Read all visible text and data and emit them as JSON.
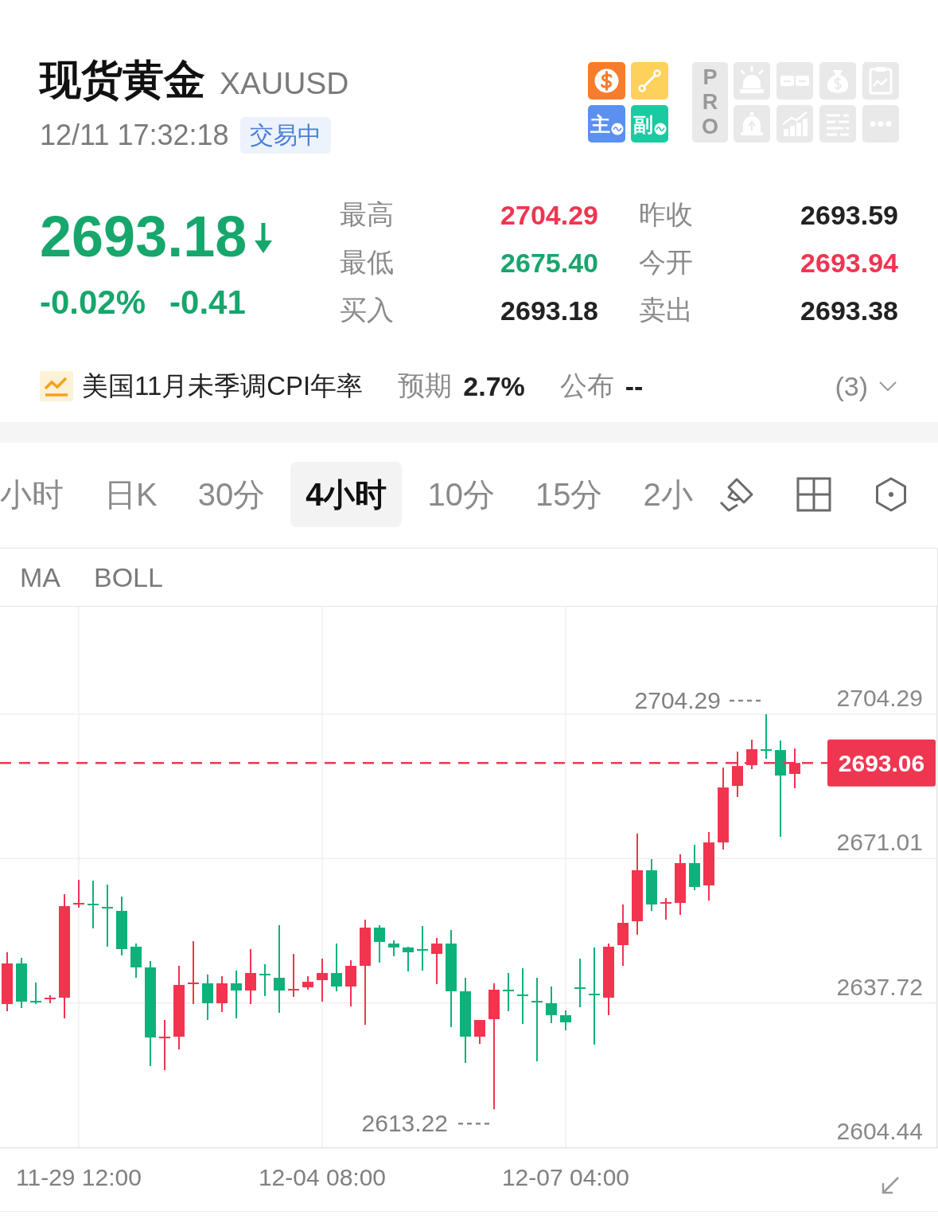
{
  "header": {
    "title": "现货黄金",
    "symbol": "XAUUSD",
    "time": "12/11 17:32:18",
    "status": "交易中"
  },
  "quick_tools": [
    {
      "kind": "dollar",
      "color": "#f77c2c"
    },
    {
      "kind": "line",
      "color": "#fdd15b"
    },
    {
      "kind": "label",
      "label": "主",
      "color": "#5c90f0"
    },
    {
      "kind": "label",
      "label": "副",
      "color": "#1ccaa1"
    }
  ],
  "pro_panel": {
    "label": "PRO",
    "disabled": true,
    "tools": [
      {
        "kind": "siren"
      },
      {
        "kind": "cards"
      },
      {
        "kind": "money_bag"
      },
      {
        "kind": "clipboard"
      },
      {
        "kind": "bell"
      },
      {
        "kind": "bar_chart"
      },
      {
        "kind": "list"
      },
      {
        "kind": "more"
      }
    ]
  },
  "quote": {
    "price": "2693.18",
    "down": true,
    "change_percent": "-0.02%",
    "change": "-0.41"
  },
  "stats": [
    {
      "label": "最高",
      "value": "2704.29",
      "color": "#ef3651"
    },
    {
      "label": "昨收",
      "value": "2693.59",
      "color": "#222222"
    },
    {
      "label": "最低",
      "value": "2675.40",
      "color": "#17a66c"
    },
    {
      "label": "今开",
      "value": "2693.94",
      "color": "#ef3651"
    },
    {
      "label": "买入",
      "value": "2693.18",
      "color": "#222222"
    },
    {
      "label": "卖出",
      "value": "2693.38",
      "color": "#222222"
    }
  ],
  "event": {
    "title": "美国11月未季调CPI年率",
    "forecast_label": "预期",
    "forecast": "2.7%",
    "actual_label": "公布",
    "actual": "--",
    "count": "(3)",
    "expanded": false
  },
  "period_tabs": [
    {
      "label": "小时",
      "selected": false
    },
    {
      "label": "日K",
      "selected": false
    },
    {
      "label": "30分",
      "selected": false
    },
    {
      "label": "4小时",
      "selected": true
    },
    {
      "label": "10分",
      "selected": false
    },
    {
      "label": "15分",
      "selected": false
    },
    {
      "label": "2小",
      "selected": false
    }
  ],
  "indicators": [
    "MA",
    "BOLL"
  ],
  "chart": {
    "chart_data": {
      "type": "candlestick",
      "categories": [
        null,
        null,
        null,
        null,
        null,
        "11-29 12:00",
        null,
        null,
        null,
        null,
        null,
        null,
        null,
        null,
        null,
        null,
        null,
        null,
        null,
        null,
        null,
        null,
        "12-04 08:00",
        null,
        null,
        null,
        null,
        null,
        null,
        null,
        null,
        null,
        null,
        null,
        null,
        null,
        null,
        null,
        null,
        "12-07 04:00",
        null,
        null,
        null,
        null,
        null,
        null,
        null,
        null,
        null,
        null,
        null,
        null,
        null,
        null,
        null,
        null
      ],
      "ohlc": [
        [
          2637.47,
          2649.4,
          2635.82,
          2646.83
        ],
        [
          2646.83,
          2648.12,
          2636.56,
          2638.02
        ],
        [
          2638.21,
          2642.43,
          2637.47,
          2637.84
        ],
        [
          2638.57,
          2639.49,
          2637.66,
          2638.94
        ],
        [
          2638.94,
          2662.8,
          2634.17,
          2660.05
        ],
        [
          2660.42,
          2666.11,
          2659.68,
          2660.78
        ],
        [
          2660.6,
          2665.92,
          2654.91,
          2660.23
        ],
        [
          2659.87,
          2665.01,
          2650.69,
          2659.5
        ],
        [
          2658.95,
          2662.25,
          2648.67,
          2650.14
        ],
        [
          2650.69,
          2651.42,
          2643.53,
          2645.92
        ],
        [
          2645.92,
          2647.39,
          2623.16,
          2629.76
        ],
        [
          2629.58,
          2633.8,
          2622.24,
          2629.95
        ],
        [
          2629.95,
          2646.28,
          2627.01,
          2641.88
        ],
        [
          2642.06,
          2651.97,
          2637.47,
          2642.43
        ],
        [
          2642.25,
          2644.26,
          2633.8,
          2637.66
        ],
        [
          2637.66,
          2643.9,
          2635.64,
          2642.25
        ],
        [
          2642.25,
          2645.18,
          2634.17,
          2640.59
        ],
        [
          2640.59,
          2650.14,
          2637.47,
          2644.63
        ],
        [
          2644.45,
          2646.65,
          2639.31,
          2644.08
        ],
        [
          2643.53,
          2655.64,
          2635.45,
          2640.59
        ],
        [
          2640.59,
          2649.04,
          2639.13,
          2640.96
        ],
        [
          2641.33,
          2643.9,
          2640.78,
          2642.61
        ],
        [
          2642.98,
          2647.94,
          2638.02,
          2644.63
        ],
        [
          2644.63,
          2651.42,
          2640.41,
          2641.51
        ],
        [
          2641.51,
          2647.57,
          2636.92,
          2646.28
        ],
        [
          2646.28,
          2656.93,
          2632.7,
          2655.09
        ],
        [
          2655.09,
          2655.64,
          2647.02,
          2651.79
        ],
        [
          2651.42,
          2652.16,
          2648.49,
          2650.51
        ],
        [
          2650.51,
          2650.69,
          2645.0,
          2649.4
        ],
        [
          2650.14,
          2655.46,
          2645.18,
          2649.77
        ],
        [
          2649.04,
          2652.71,
          2642.06,
          2651.42
        ],
        [
          2651.42,
          2654.54,
          2632.15,
          2640.41
        ],
        [
          2640.41,
          2643.53,
          2623.89,
          2629.95
        ],
        [
          2629.95,
          2633.8,
          2628.3,
          2633.8
        ],
        [
          2633.99,
          2642.25,
          2613.22,
          2640.78
        ],
        [
          2640.78,
          2644.63,
          2635.82,
          2640.41
        ],
        [
          2639.68,
          2645.73,
          2632.88,
          2639.31
        ],
        [
          2638.21,
          2643.53,
          2624.26,
          2637.84
        ],
        [
          2637.66,
          2641.51,
          2633.07,
          2634.9
        ],
        [
          2634.9,
          2636.01,
          2631.42,
          2633.25
        ],
        [
          2641.33,
          2647.94,
          2636.74,
          2640.96
        ],
        [
          2639.86,
          2650.51,
          2628.11,
          2639.49
        ],
        [
          2638.94,
          2651.42,
          2634.9,
          2650.69
        ],
        [
          2651.06,
          2660.42,
          2646.28,
          2656.2
        ],
        [
          2656.56,
          2676.75,
          2653.44,
          2668.31
        ],
        [
          2668.31,
          2670.88,
          2658.95,
          2660.42
        ],
        [
          2660.6,
          2661.89,
          2656.93,
          2660.97
        ],
        [
          2660.78,
          2671.98,
          2658.03,
          2669.96
        ],
        [
          2669.96,
          2674.18,
          2663.72,
          2664.46
        ],
        [
          2664.82,
          2677.12,
          2661.33,
          2674.73
        ],
        [
          2674.73,
          2691.99,
          2673.08,
          2687.4
        ],
        [
          2687.77,
          2695.66,
          2685.2,
          2692.35
        ],
        [
          2692.54,
          2698.41,
          2691.62,
          2696.21
        ],
        [
          2696.21,
          2704.29,
          2694.01,
          2695.84
        ],
        [
          2696.03,
          2698.23,
          2676.02,
          2690.15
        ],
        [
          2690.52,
          2696.39,
          2687.22,
          2693.06
        ]
      ],
      "ylim": [
        2604.44,
        2729.07
      ],
      "yticks": [
        2604.44,
        2637.72,
        2671.01,
        2704.29
      ],
      "grid": true,
      "ref_lines": [
        {
          "axis": "y",
          "value": 2693.06,
          "label": "2693.06",
          "color": "#ef3651"
        }
      ],
      "annotations": [
        "2704.29",
        "2613.22"
      ]
    }
  }
}
